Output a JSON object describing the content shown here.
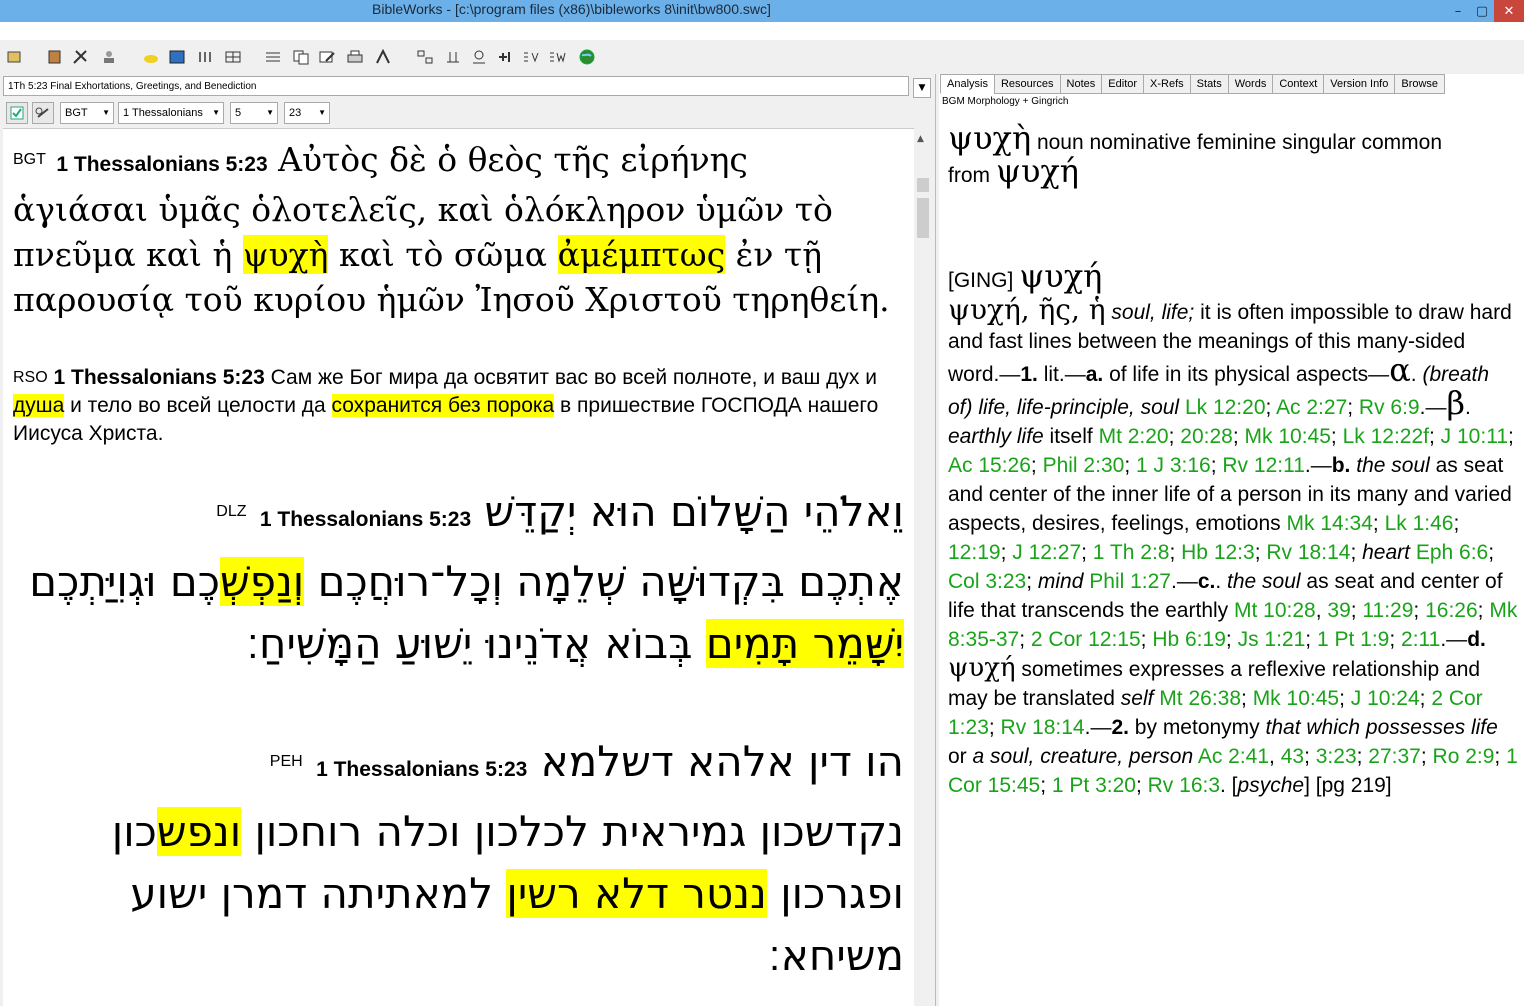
{
  "window": {
    "title": "BibleWorks - [c:\\program files (x86)\\bibleworks 8\\init\\bw800.swc]"
  },
  "nav": {
    "verse_title": "1Th 5:23 Final Exhortations, Greetings, and Benediction",
    "version": "BGT",
    "book": "1 Thessalonians",
    "chapter": "5",
    "verse": "23"
  },
  "bgt": {
    "version": "BGT",
    "ref": "1 Thessalonians 5:23",
    "t1": "Αὐτὸς δὲ ὁ θεὸς τῆς εἰρήνης ἁγιάσαι ὑμᾶς ὁλοτελεῖς, καὶ ὁλόκληρον ὑμῶν τὸ πνεῦμα καὶ ἡ ",
    "h1": "ψυχὴ",
    "t2": " καὶ τὸ σῶμα ",
    "h2": "ἀμέμπτως",
    "t3": " ἐν τῇ παρουσίᾳ τοῦ κυρίου ἡμῶν Ἰησοῦ Χριστοῦ τηρηθείη."
  },
  "rso": {
    "version": "RSO",
    "ref": "1 Thessalonians 5:23",
    "t1": " Сам же Бог мира да освятит вас во всей полноте, и ваш дух и ",
    "h1": "душа",
    "t2": " и тело во всей целости да ",
    "h2": "сохранится без порока",
    "t3": " в пришествие ГОСПОДА нашего Иисуса Христа."
  },
  "dlz": {
    "version": "DLZ",
    "ref": "1 Thessalonians 5:23",
    "t1": "וֵאלֹהֵי הַשָּׁלוֹם הוּא יְקַדֵּשׁ ",
    "t2": "אֶתְכֶם בִּקְדוּשָּׁה שְׁלֵמָה וְכָל־רוּחֲכֶם ",
    "h1": "וְנַפְשְׁ",
    "t3": "כֶם וּגְוִיַּתְכֶם ",
    "h2": "יִשָּׁמֵר תָּמִים",
    "t4": " בְּבוֹא אֲדֹנֵינוּ יֵשׁוּעַ הַמָּשִׁיחַ׃"
  },
  "peh": {
    "version": "PEH",
    "ref": "1 Thessalonians 5:23",
    "t1": "הו דין אלהא דשלמא ",
    "t2": "נקדשכון גמיראית לכלכון וכלה רוחכון ",
    "h1": "ונפש",
    "t3": "כון ופגרכון ",
    "h2": "ננטר דלא רשין",
    "t4": " למאתיתה דמרן ישוע משיחא׃"
  },
  "tabs": [
    "Analysis",
    "Resources",
    "Notes",
    "Editor",
    "X-Refs",
    "Stats",
    "Words",
    "Context",
    "Version Info",
    "Browse"
  ],
  "analysis": {
    "header": "BGM Morphology + Gingrich",
    "word": "ψυχὴ",
    "parse": " noun nominative feminine singular common",
    "from_label": "from ",
    "lemma": "ψυχή",
    "ging_label": "[GING] ",
    "ging_word": "ψυχή",
    "entry_head": "ψυχή, ῆς, ἡ",
    "s01": " soul, life;",
    "s02": " it is often impossible to draw hard and fast lines between the meanings of this many-sided word.—",
    "s03": "1.",
    "s04": " lit.—",
    "s05": "a.",
    "s06": " of life in its physical aspects—",
    "s07": "α",
    "s08": ". ",
    "s09": "(breath of) life, life-principle, soul",
    "s10": " ",
    "r01": "Lk 12:20",
    "s11": "; ",
    "r02": "Ac 2:27",
    "s12": "; ",
    "r03": "Rv 6:9",
    "s13": ".—",
    "s14": "β",
    "s15": ". ",
    "s16": "earthly life",
    "s17": " itself ",
    "r04": "Mt 2:20",
    "s18": "; ",
    "r05": "20:28",
    "s19": "; ",
    "r06": "Mk 10:45",
    "s20": "; ",
    "r07": "Lk 12:22f",
    "s21": "; ",
    "r08": "J 10:11",
    "s22": "; ",
    "r09": "Ac 15:26",
    "s23": "; ",
    "r10": "Phil 2:30",
    "s24": "; ",
    "r11": "1 J 3:16",
    "s25": "; ",
    "r12": "Rv 12:11",
    "s26": ".—",
    "s27": "b.",
    "s28": " the soul",
    "s29": " as seat and center of the inner life of a person in its many and varied aspects, desires, feelings, emotions ",
    "r13": "Mk 14:34",
    "s30": "; ",
    "r14": "Lk 1:46",
    "s31": "; ",
    "r15": "12:19",
    "s32": "; ",
    "r16": "J 12:27",
    "s33": "; ",
    "r17": "1 Th 2:8",
    "s34": "; ",
    "r18": "Hb 12:3",
    "s35": "; ",
    "r19": "Rv 18:14",
    "s36": "; ",
    "s37": "heart",
    "s38": " ",
    "r20": "Eph 6:6",
    "s39": "; ",
    "r21": "Col 3:23",
    "s40": "; ",
    "s41": "mind",
    "s42": " ",
    "r22": "Phil 1:27",
    "s43": ".—",
    "s44": "c.",
    "s45": ". ",
    "s46": "the soul",
    "s47": " as seat and center of life that transcends the earthly ",
    "r23": "Mt 10:28",
    "s48": ", ",
    "r24": "39",
    "s49": "; ",
    "r25": "11:29",
    "s50": "; ",
    "r26": "16:26",
    "s51": "; ",
    "r27": "Mk 8:35-37",
    "s52": "; ",
    "r28": "2 Cor 12:15",
    "s53": "; ",
    "r29": "Hb 6:19",
    "s54": "; ",
    "r30": "Js 1:21",
    "s55": "; ",
    "r31": "1 Pt 1:9",
    "s56": "; ",
    "r32": "2:11",
    "s57": ".—",
    "s58": "d.",
    "s59": " ",
    "s60": "ψυχή",
    "s61": " sometimes expresses a reflexive relationship and may be translated ",
    "s62": "self",
    "s63": " ",
    "r33": "Mt 26:38",
    "s64": "; ",
    "r34": "Mk 10:45",
    "s65": "; ",
    "r35": "J 10:24",
    "s66": "; ",
    "r36": "2 Cor 1:23",
    "s67": "; ",
    "r37": "Rv 18:14",
    "s68": ".—",
    "s69": "2.",
    "s70": " by metonymy ",
    "s71": "that which possesses life",
    "s72": " or ",
    "s73": "a soul, creature, person",
    "s74": " ",
    "r38": "Ac 2:41",
    "s75": ", ",
    "r39": "43",
    "s76": "; ",
    "r40": "3:23",
    "s77": "; ",
    "r41": "27:37",
    "s78": "; ",
    "r42": "Ro 2:9",
    "s79": "; ",
    "r43": "1 Cor 15:45",
    "s80": "; ",
    "r44": "1 Pt 3:20",
    "s81": "; ",
    "r45": "Rv 16:3",
    "s82": ". [",
    "s83": "psyche",
    "s84": "] [pg 219]"
  },
  "colors": {
    "titlebar": "#6bb0e8",
    "highlight": "#ffff00",
    "reference": "#1aa31a"
  }
}
